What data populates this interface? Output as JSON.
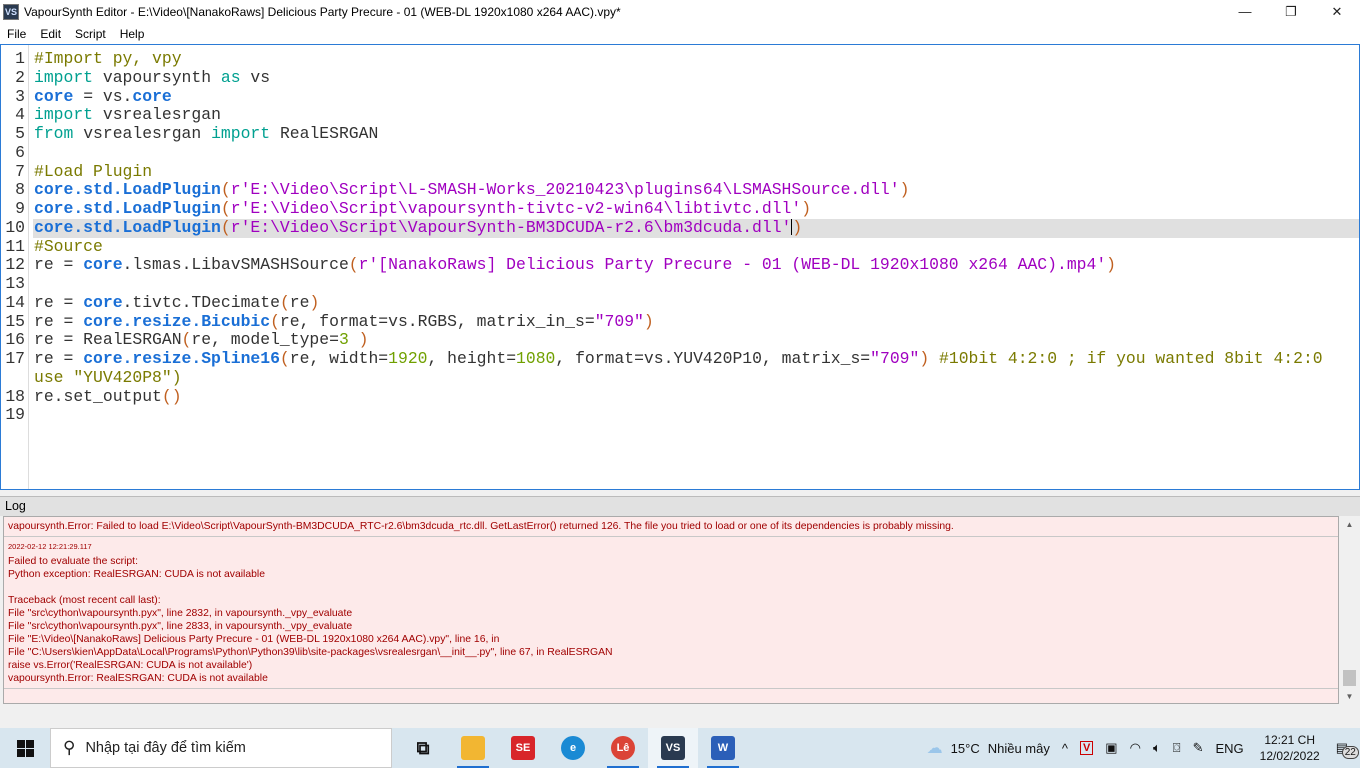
{
  "window": {
    "title": "VapourSynth Editor - E:\\Video\\[NanakoRaws] Delicious Party Precure - 01 (WEB-DL 1920x1080 x264 AAC).vpy*",
    "app_icon": "VS",
    "minimize": "—",
    "maximize": "❐",
    "close": "✕"
  },
  "menu": [
    "File",
    "Edit",
    "Script",
    "Help"
  ],
  "editor": {
    "current_line": 10,
    "colors": {
      "keyword": "#00a090",
      "object": "#1a6fd6",
      "comment": "#7a7a00",
      "string": "#a000c0",
      "paren": "#c06020",
      "number": "#70a000"
    },
    "lines": [
      {
        "n": "1",
        "t": [
          [
            "cm",
            "#Import py, vpy"
          ]
        ]
      },
      {
        "n": "2",
        "t": [
          [
            "kw",
            "import"
          ],
          [
            "tx",
            " vapoursynth "
          ],
          [
            "kw",
            "as"
          ],
          [
            "tx",
            " vs"
          ]
        ]
      },
      {
        "n": "3",
        "t": [
          [
            "obj",
            "core"
          ],
          [
            "tx",
            " = vs."
          ],
          [
            "obj",
            "core"
          ]
        ]
      },
      {
        "n": "4",
        "t": [
          [
            "kw",
            "import"
          ],
          [
            "tx",
            " vsrealesrgan"
          ]
        ]
      },
      {
        "n": "5",
        "t": [
          [
            "kw",
            "from"
          ],
          [
            "tx",
            " vsrealesrgan "
          ],
          [
            "kw",
            "import"
          ],
          [
            "tx",
            " RealESRGAN"
          ]
        ]
      },
      {
        "n": "6",
        "t": []
      },
      {
        "n": "7",
        "t": [
          [
            "cm",
            "#Load Plugin"
          ]
        ]
      },
      {
        "n": "8",
        "t": [
          [
            "obj",
            "core.std.LoadPlugin"
          ],
          [
            "pn",
            "("
          ],
          [
            "st",
            "r'E:\\Video\\Script\\L-SMASH-Works_20210423\\plugins64\\LSMASHSource.dll'"
          ],
          [
            "pn",
            ")"
          ]
        ]
      },
      {
        "n": "9",
        "t": [
          [
            "obj",
            "core.std.LoadPlugin"
          ],
          [
            "pn",
            "("
          ],
          [
            "st",
            "r'E:\\Video\\Script\\vapoursynth-tivtc-v2-win64\\libtivtc.dll'"
          ],
          [
            "pn",
            ")"
          ]
        ]
      },
      {
        "n": "10",
        "t": [
          [
            "obj",
            "core.std.LoadPlugin"
          ],
          [
            "pn",
            "("
          ],
          [
            "st",
            "r'E:\\Video\\Script\\VapourSynth-BM3DCUDA-r2.6\\bm3dcuda.dll'"
          ],
          [
            "pn",
            ")"
          ]
        ]
      },
      {
        "n": "11",
        "t": [
          [
            "cm",
            "#Source"
          ]
        ]
      },
      {
        "n": "12",
        "t": [
          [
            "tx",
            "re = "
          ],
          [
            "obj",
            "core"
          ],
          [
            "tx",
            ".lsmas.LibavSMASHSource"
          ],
          [
            "pn",
            "("
          ],
          [
            "st",
            "r'[NanakoRaws] Delicious Party Precure - 01 (WEB-DL 1920x1080 x264 AAC).mp4'"
          ],
          [
            "pn",
            ")"
          ]
        ]
      },
      {
        "n": "13",
        "t": []
      },
      {
        "n": "14",
        "t": [
          [
            "tx",
            "re = "
          ],
          [
            "obj",
            "core"
          ],
          [
            "tx",
            ".tivtc.TDecimate"
          ],
          [
            "pn",
            "("
          ],
          [
            "tx",
            "re"
          ],
          [
            "pn",
            ")"
          ]
        ]
      },
      {
        "n": "15",
        "t": [
          [
            "tx",
            "re = "
          ],
          [
            "obj",
            "core.resize.Bicubic"
          ],
          [
            "pn",
            "("
          ],
          [
            "tx",
            "re, format=vs.RGBS, matrix_in_s="
          ],
          [
            "st",
            "\"709\""
          ],
          [
            "pn",
            ")"
          ]
        ]
      },
      {
        "n": "16",
        "t": [
          [
            "tx",
            "re = RealESRGAN"
          ],
          [
            "pn",
            "("
          ],
          [
            "tx",
            "re, model_type="
          ],
          [
            "nm",
            "3"
          ],
          [
            "tx",
            " "
          ],
          [
            "pn",
            ")"
          ]
        ]
      },
      {
        "n": "17",
        "t": [
          [
            "tx",
            "re = "
          ],
          [
            "obj",
            "core.resize.Spline16"
          ],
          [
            "pn",
            "("
          ],
          [
            "tx",
            "re, width="
          ],
          [
            "nm",
            "1920"
          ],
          [
            "tx",
            ", height="
          ],
          [
            "nm",
            "1080"
          ],
          [
            "tx",
            ", format=vs.YUV420P10, matrix_s="
          ],
          [
            "st",
            "\"709\""
          ],
          [
            "pn",
            ")"
          ],
          [
            "tx",
            " "
          ],
          [
            "cm",
            "#10bit 4:2:0 ; if you wanted 8bit 4:2:0"
          ]
        ]
      },
      {
        "n": "",
        "t": [
          [
            "cm",
            "use \"YUV420P8\")"
          ]
        ]
      },
      {
        "n": "18",
        "t": [
          [
            "tx",
            "re.set_output"
          ],
          [
            "pn",
            "()"
          ]
        ]
      },
      {
        "n": "19",
        "t": []
      }
    ]
  },
  "log": {
    "title": "Log",
    "entries": [
      {
        "timestamp": "",
        "lines": [
          "vapoursynth.Error: Failed to load E:\\Video\\Script\\VapourSynth-BM3DCUDA_RTC-r2.6\\bm3dcuda_rtc.dll. GetLastError() returned 126. The file you tried to load or one of its dependencies is probably missing."
        ]
      },
      {
        "timestamp": "2022-02-12 12:21:29.117",
        "lines": [
          "Failed to evaluate the script:",
          "Python exception: RealESRGAN: CUDA is not available",
          "",
          "Traceback (most recent call last):",
          "File \"src\\cython\\vapoursynth.pyx\", line 2832, in vapoursynth._vpy_evaluate",
          "File \"src\\cython\\vapoursynth.pyx\", line 2833, in vapoursynth._vpy_evaluate",
          "File \"E:\\Video\\[NanakoRaws] Delicious Party Precure - 01 (WEB-DL 1920x1080 x264 AAC).vpy\", line 16, in",
          "File \"C:\\Users\\kien\\AppData\\Local\\Programs\\Python\\Python39\\lib\\site-packages\\vsrealesrgan\\__init__.py\", line 67, in RealESRGAN",
          "raise vs.Error('RealESRGAN: CUDA is not available')",
          "vapoursynth.Error: RealESRGAN: CUDA is not available"
        ]
      }
    ]
  },
  "taskbar": {
    "search_placeholder": "Nhập tại đây để tìm kiếm",
    "apps": [
      {
        "name": "task-view",
        "label": "⧉",
        "color": "transparent"
      },
      {
        "name": "file-explorer",
        "label": "",
        "color": "#f2b632"
      },
      {
        "name": "subtitle-edit",
        "label": "SE",
        "color": "#d8252a"
      },
      {
        "name": "edge",
        "label": "e",
        "color": "#1a8ad4"
      },
      {
        "name": "chrome",
        "label": "Lê",
        "color": "#db4437"
      },
      {
        "name": "vapoursynth-editor",
        "label": "VS",
        "color": "#2a3a50"
      },
      {
        "name": "word",
        "label": "W",
        "color": "#2b5fb8"
      }
    ],
    "weather": {
      "temp": "15°C",
      "desc": "Nhiều mây"
    },
    "language": "ENG",
    "time": "12:21 CH",
    "date": "12/02/2022",
    "notifications": "22"
  }
}
